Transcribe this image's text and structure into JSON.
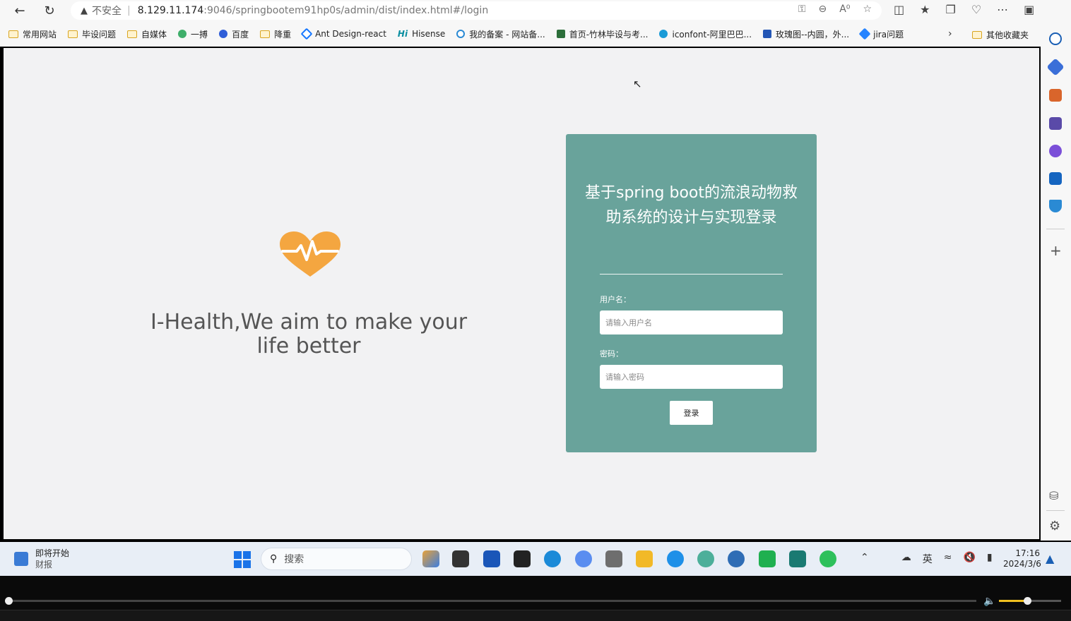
{
  "browser": {
    "insecure_label": "不安全",
    "url_host": "8.129.11.174",
    "url_path": ":9046/springbootem91hp0s/admin/dist/index.html#/login"
  },
  "bookmarks": [
    {
      "label": "常用网站",
      "icon": "folder-icon"
    },
    {
      "label": "毕设问题",
      "icon": "folder-icon"
    },
    {
      "label": "自媒体",
      "icon": "folder-icon"
    },
    {
      "label": "一搏",
      "icon": "green-circle-icon"
    },
    {
      "label": "百度",
      "icon": "baidu-paw-icon"
    },
    {
      "label": "降重",
      "icon": "folder-icon"
    },
    {
      "label": "Ant Design-react",
      "icon": "ant-design-icon"
    },
    {
      "label": "Hisense",
      "icon": "hisense-icon"
    },
    {
      "label": "我的备案 - 网站备...",
      "icon": "cloud-icon"
    },
    {
      "label": "首页-竹林毕设与考...",
      "icon": "bamboo-icon"
    },
    {
      "label": "iconfont-阿里巴巴...",
      "icon": "iconfont-icon"
    },
    {
      "label": "玫瑰图--内圆，外...",
      "icon": "chart-icon"
    },
    {
      "label": "jira问题",
      "icon": "jira-icon"
    }
  ],
  "bookmarks_other": "其他收藏夹",
  "page": {
    "tagline": "I-Health,We aim to make your life better"
  },
  "login": {
    "title": "基于spring boot的流浪动物救助系统的设计与实现登录",
    "username_label": "用户名：",
    "username_placeholder": "请输入用户名",
    "password_label": "密码：",
    "password_placeholder": "请输入密码",
    "submit_label": "登录"
  },
  "taskbar": {
    "weather_title": "即将开始",
    "weather_sub": "财报",
    "search_placeholder": "搜索",
    "ime": "英",
    "time": "17:16",
    "date": "2024/3/6"
  },
  "player": {
    "progress": 0.0,
    "volume": 0.45
  },
  "colors": {
    "card": "#69a39b",
    "heart": "#f4a640",
    "page_bg": "#f2f2f3"
  }
}
